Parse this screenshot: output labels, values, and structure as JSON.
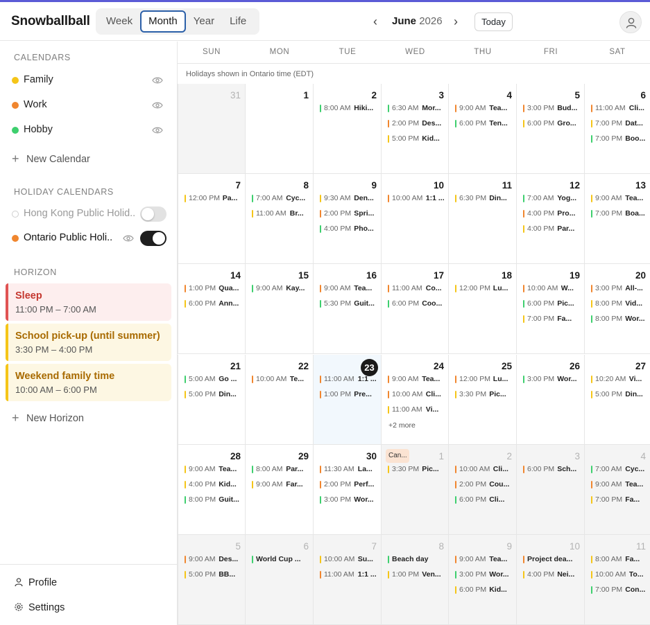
{
  "app": {
    "name": "Snowballball"
  },
  "view_tabs": [
    {
      "label": "Week",
      "active": false
    },
    {
      "label": "Month",
      "active": true
    },
    {
      "label": "Year",
      "active": false
    },
    {
      "label": "Life",
      "active": false
    }
  ],
  "nav": {
    "month": "June",
    "year": "2026",
    "today_label": "Today"
  },
  "sidebar": {
    "calendars_title": "CALENDARS",
    "calendars": [
      {
        "name": "Family",
        "color": "#f5c518"
      },
      {
        "name": "Work",
        "color": "#f0862f"
      },
      {
        "name": "Hobby",
        "color": "#3ecf6e"
      }
    ],
    "new_calendar": "New Calendar",
    "holiday_title": "HOLIDAY CALENDARS",
    "holidays": [
      {
        "name": "Hong Kong Public Holid...",
        "enabled": false,
        "color": "#cfcfcf"
      },
      {
        "name": "Ontario Public Holi...",
        "enabled": true,
        "color": "#f0862f"
      }
    ],
    "horizon_title": "HORIZON",
    "horizons": [
      {
        "title": "Sleep",
        "time": "11:00 PM – 7:00 AM",
        "bg": "#fdeeee",
        "bar": "#e05353",
        "fg": "#c4372f"
      },
      {
        "title": "School pick-up (until summer)",
        "time": "3:30 PM – 4:00 PM",
        "bg": "#fdf7e3",
        "bar": "#f5c518",
        "fg": "#a86a00"
      },
      {
        "title": "Weekend family time",
        "time": "10:00 AM – 6:00 PM",
        "bg": "#fdf7e3",
        "bar": "#f5c518",
        "fg": "#a86a00"
      }
    ],
    "new_horizon": "New Horizon",
    "profile": "Profile",
    "settings": "Settings"
  },
  "calendar": {
    "weekdays": [
      "SUN",
      "MON",
      "TUE",
      "WED",
      "THU",
      "FRI",
      "SAT"
    ],
    "holiday_note": "Holidays shown in Ontario time (EDT)",
    "colors": {
      "family": "#f5c518",
      "work": "#f0862f",
      "hobby": "#3ecf6e"
    },
    "weeks": [
      [
        {
          "day": "31",
          "out": true,
          "events": []
        },
        {
          "day": "1",
          "events": []
        },
        {
          "day": "2",
          "events": [
            {
              "time": "8:00 AM",
              "title": "Hiki...",
              "cal": "hobby"
            }
          ]
        },
        {
          "day": "3",
          "events": [
            {
              "time": "6:30 AM",
              "title": "Mor...",
              "cal": "hobby"
            },
            {
              "time": "2:00 PM",
              "title": "Des...",
              "cal": "work"
            },
            {
              "time": "5:00 PM",
              "title": "Kid...",
              "cal": "family"
            }
          ]
        },
        {
          "day": "4",
          "events": [
            {
              "time": "9:00 AM",
              "title": "Tea...",
              "cal": "work"
            },
            {
              "time": "6:00 PM",
              "title": "Ten...",
              "cal": "hobby"
            }
          ]
        },
        {
          "day": "5",
          "events": [
            {
              "time": "3:00 PM",
              "title": "Bud...",
              "cal": "work"
            },
            {
              "time": "6:00 PM",
              "title": "Gro...",
              "cal": "family"
            }
          ]
        },
        {
          "day": "6",
          "events": [
            {
              "time": "11:00 AM",
              "title": "Cli...",
              "cal": "work"
            },
            {
              "time": "7:00 PM",
              "title": "Dat...",
              "cal": "family"
            },
            {
              "time": "7:00 PM",
              "title": "Boo...",
              "cal": "hobby"
            }
          ]
        }
      ],
      [
        {
          "day": "7",
          "events": [
            {
              "time": "12:00 PM",
              "title": "Pa...",
              "cal": "family"
            }
          ]
        },
        {
          "day": "8",
          "events": [
            {
              "time": "7:00 AM",
              "title": "Cyc...",
              "cal": "hobby"
            },
            {
              "time": "11:00 AM",
              "title": "Br...",
              "cal": "family"
            }
          ]
        },
        {
          "day": "9",
          "events": [
            {
              "time": "9:30 AM",
              "title": "Den...",
              "cal": "family"
            },
            {
              "time": "2:00 PM",
              "title": "Spri...",
              "cal": "work"
            },
            {
              "time": "4:00 PM",
              "title": "Pho...",
              "cal": "hobby"
            }
          ]
        },
        {
          "day": "10",
          "events": [
            {
              "time": "10:00 AM",
              "title": "1:1 ...",
              "cal": "work"
            }
          ]
        },
        {
          "day": "11",
          "events": [
            {
              "time": "6:30 PM",
              "title": "Din...",
              "cal": "family"
            }
          ]
        },
        {
          "day": "12",
          "events": [
            {
              "time": "7:00 AM",
              "title": "Yog...",
              "cal": "hobby"
            },
            {
              "time": "4:00 PM",
              "title": "Pro...",
              "cal": "work"
            },
            {
              "time": "4:00 PM",
              "title": "Par...",
              "cal": "family"
            }
          ]
        },
        {
          "day": "13",
          "events": [
            {
              "time": "9:00 AM",
              "title": "Tea...",
              "cal": "family"
            },
            {
              "time": "7:00 PM",
              "title": "Boa...",
              "cal": "hobby"
            }
          ]
        }
      ],
      [
        {
          "day": "14",
          "events": [
            {
              "time": "1:00 PM",
              "title": "Qua...",
              "cal": "work"
            },
            {
              "time": "6:00 PM",
              "title": "Ann...",
              "cal": "family"
            }
          ]
        },
        {
          "day": "15",
          "events": [
            {
              "time": "9:00 AM",
              "title": "Kay...",
              "cal": "hobby"
            }
          ]
        },
        {
          "day": "16",
          "events": [
            {
              "time": "9:00 AM",
              "title": "Tea...",
              "cal": "work"
            },
            {
              "time": "5:30 PM",
              "title": "Guit...",
              "cal": "hobby"
            }
          ]
        },
        {
          "day": "17",
          "events": [
            {
              "time": "11:00 AM",
              "title": "Co...",
              "cal": "work"
            },
            {
              "time": "6:00 PM",
              "title": "Coo...",
              "cal": "hobby"
            }
          ]
        },
        {
          "day": "18",
          "events": [
            {
              "time": "12:00 PM",
              "title": "Lu...",
              "cal": "family"
            }
          ]
        },
        {
          "day": "19",
          "events": [
            {
              "time": "10:00 AM",
              "title": "W...",
              "cal": "work"
            },
            {
              "time": "6:00 PM",
              "title": "Pic...",
              "cal": "hobby"
            },
            {
              "time": "7:00 PM",
              "title": "Fa...",
              "cal": "family"
            }
          ]
        },
        {
          "day": "20",
          "events": [
            {
              "time": "3:00 PM",
              "title": "All-...",
              "cal": "work"
            },
            {
              "time": "8:00 PM",
              "title": "Vid...",
              "cal": "family"
            },
            {
              "time": "8:00 PM",
              "title": "Wor...",
              "cal": "hobby"
            }
          ]
        }
      ],
      [
        {
          "day": "21",
          "events": [
            {
              "time": "5:00 AM",
              "title": "Go ...",
              "cal": "hobby"
            },
            {
              "time": "5:00 PM",
              "title": "Din...",
              "cal": "family"
            }
          ]
        },
        {
          "day": "22",
          "events": [
            {
              "time": "10:00 AM",
              "title": "Te...",
              "cal": "work"
            }
          ]
        },
        {
          "day": "23",
          "today": true,
          "events": [
            {
              "time": "11:00 AM",
              "title": "1:1 ...",
              "cal": "work"
            },
            {
              "time": "1:00 PM",
              "title": "Pre...",
              "cal": "work"
            }
          ]
        },
        {
          "day": "24",
          "events": [
            {
              "time": "9:00 AM",
              "title": "Tea...",
              "cal": "work"
            },
            {
              "time": "10:00 AM",
              "title": "Cli...",
              "cal": "work"
            },
            {
              "time": "11:00 AM",
              "title": "Vi...",
              "cal": "family"
            }
          ],
          "more": "+2 more"
        },
        {
          "day": "25",
          "events": [
            {
              "time": "12:00 PM",
              "title": "Lu...",
              "cal": "work"
            },
            {
              "time": "3:30 PM",
              "title": "Pic...",
              "cal": "family"
            }
          ]
        },
        {
          "day": "26",
          "events": [
            {
              "time": "3:00 PM",
              "title": "Wor...",
              "cal": "hobby"
            }
          ]
        },
        {
          "day": "27",
          "events": [
            {
              "time": "10:20 AM",
              "title": "Vi...",
              "cal": "family"
            },
            {
              "time": "5:00 PM",
              "title": "Din...",
              "cal": "family"
            }
          ]
        }
      ],
      [
        {
          "day": "28",
          "events": [
            {
              "time": "9:00 AM",
              "title": "Tea...",
              "cal": "family"
            },
            {
              "time": "4:00 PM",
              "title": "Kid...",
              "cal": "family"
            },
            {
              "time": "8:00 PM",
              "title": "Guit...",
              "cal": "hobby"
            }
          ]
        },
        {
          "day": "29",
          "events": [
            {
              "time": "8:00 AM",
              "title": "Par...",
              "cal": "hobby"
            },
            {
              "time": "9:00 AM",
              "title": "Far...",
              "cal": "family"
            }
          ]
        },
        {
          "day": "30",
          "events": [
            {
              "time": "11:30 AM",
              "title": "La...",
              "cal": "work"
            },
            {
              "time": "2:00 PM",
              "title": "Perf...",
              "cal": "work"
            },
            {
              "time": "3:00 PM",
              "title": "Wor...",
              "cal": "hobby"
            }
          ]
        },
        {
          "day": "1",
          "out": true,
          "chip": "Can...",
          "events": [
            {
              "time": "3:30 PM",
              "title": "Pic...",
              "cal": "family"
            }
          ]
        },
        {
          "day": "2",
          "out": true,
          "events": [
            {
              "time": "10:00 AM",
              "title": "Cli...",
              "cal": "work"
            },
            {
              "time": "2:00 PM",
              "title": "Cou...",
              "cal": "work"
            },
            {
              "time": "6:00 PM",
              "title": "Cli...",
              "cal": "hobby"
            }
          ]
        },
        {
          "day": "3",
          "out": true,
          "events": [
            {
              "time": "6:00 PM",
              "title": "Sch...",
              "cal": "work"
            }
          ]
        },
        {
          "day": "4",
          "out": true,
          "events": [
            {
              "time": "7:00 AM",
              "title": "Cyc...",
              "cal": "hobby"
            },
            {
              "time": "9:00 AM",
              "title": "Tea...",
              "cal": "work"
            },
            {
              "time": "7:00 PM",
              "title": "Fa...",
              "cal": "family"
            }
          ]
        }
      ],
      [
        {
          "day": "5",
          "out": true,
          "events": [
            {
              "time": "9:00 AM",
              "title": "Des...",
              "cal": "work"
            },
            {
              "time": "5:00 PM",
              "title": "BB...",
              "cal": "family"
            }
          ]
        },
        {
          "day": "6",
          "out": true,
          "events": [
            {
              "time": "",
              "title": "World Cup ...",
              "cal": "hobby"
            }
          ]
        },
        {
          "day": "7",
          "out": true,
          "events": [
            {
              "time": "10:00 AM",
              "title": "Su...",
              "cal": "family"
            },
            {
              "time": "11:00 AM",
              "title": "1:1 ...",
              "cal": "work"
            }
          ]
        },
        {
          "day": "8",
          "out": true,
          "events": [
            {
              "time": "",
              "title": "Beach day",
              "cal": "hobby"
            },
            {
              "time": "1:00 PM",
              "title": "Ven...",
              "cal": "family"
            }
          ]
        },
        {
          "day": "9",
          "out": true,
          "events": [
            {
              "time": "9:00 AM",
              "title": "Tea...",
              "cal": "work"
            },
            {
              "time": "3:00 PM",
              "title": "Wor...",
              "cal": "hobby"
            },
            {
              "time": "6:00 PM",
              "title": "Kid...",
              "cal": "family"
            }
          ]
        },
        {
          "day": "10",
          "out": true,
          "events": [
            {
              "time": "",
              "title": "Project dea...",
              "cal": "work"
            },
            {
              "time": "4:00 PM",
              "title": "Nei...",
              "cal": "family"
            }
          ]
        },
        {
          "day": "11",
          "out": true,
          "events": [
            {
              "time": "8:00 AM",
              "title": "Fa...",
              "cal": "family"
            },
            {
              "time": "10:00 AM",
              "title": "To...",
              "cal": "family"
            },
            {
              "time": "7:00 PM",
              "title": "Con...",
              "cal": "hobby"
            }
          ]
        }
      ]
    ]
  }
}
